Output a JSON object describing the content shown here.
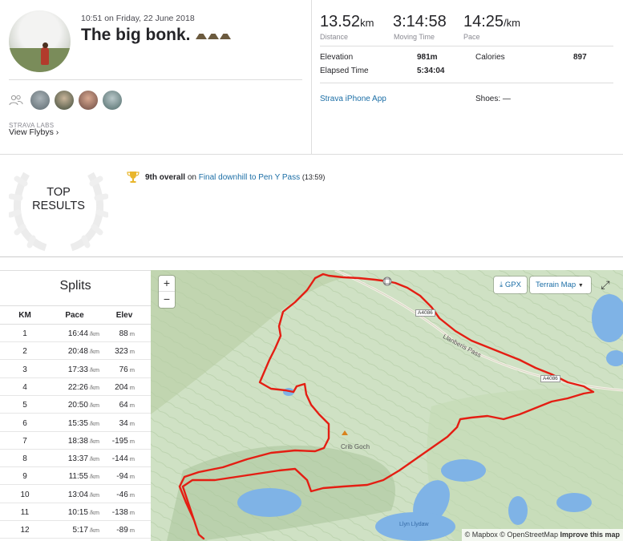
{
  "activity": {
    "date": "10:51 on Friday, 22 June 2018",
    "title": "The big bonk.",
    "labs": "STRAVA LABS",
    "flybys": "View Flybys ›"
  },
  "stats": {
    "distance_value": "13.52",
    "distance_unit": "km",
    "distance_label": "Distance",
    "moving_value": "3:14:58",
    "moving_label": "Moving Time",
    "pace_value": "14:25",
    "pace_unit": "/km",
    "pace_label": "Pace",
    "elevation_label": "Elevation",
    "elevation_value": "981m",
    "calories_label": "Calories",
    "calories_value": "897",
    "elapsed_label": "Elapsed Time",
    "elapsed_value": "5:34:04",
    "device": "Strava iPhone App",
    "shoes": "Shoes: —"
  },
  "results": {
    "heading_line1": "TOP",
    "heading_line2": "RESULTS",
    "rank": "9th overall",
    "on": "on",
    "segment": "Final downhill to Pen Y Pass",
    "time": "(13:59)"
  },
  "splits": {
    "title": "Splits",
    "col_km": "KM",
    "col_pace": "Pace",
    "col_elev": "Elev",
    "pace_unit": "/km",
    "elev_unit": "m",
    "rows": [
      {
        "km": "1",
        "pace": "16:44",
        "elev": "88"
      },
      {
        "km": "2",
        "pace": "20:48",
        "elev": "323"
      },
      {
        "km": "3",
        "pace": "17:33",
        "elev": "76"
      },
      {
        "km": "4",
        "pace": "22:26",
        "elev": "204"
      },
      {
        "km": "5",
        "pace": "20:50",
        "elev": "64"
      },
      {
        "km": "6",
        "pace": "15:35",
        "elev": "34"
      },
      {
        "km": "7",
        "pace": "18:38",
        "elev": "-195"
      },
      {
        "km": "8",
        "pace": "13:37",
        "elev": "-144"
      },
      {
        "km": "9",
        "pace": "11:55",
        "elev": "-94"
      },
      {
        "km": "10",
        "pace": "13:04",
        "elev": "-46"
      },
      {
        "km": "11",
        "pace": "10:15",
        "elev": "-138"
      },
      {
        "km": "12",
        "pace": "5:17",
        "elev": "-89"
      }
    ]
  },
  "map": {
    "zoom_in": "+",
    "zoom_out": "−",
    "gpx": "GPX",
    "terrain": "Terrain Map",
    "attribution_a": "© Mapbox © OpenStreetMap",
    "attribution_b": "Improve this map",
    "label_pass": "Llanberis Pass",
    "label_crib": "Crib Goch",
    "road1": "A4086",
    "road2": "A4086",
    "lake": "Llyn Llydaw",
    "route_color": "#e41e13"
  }
}
